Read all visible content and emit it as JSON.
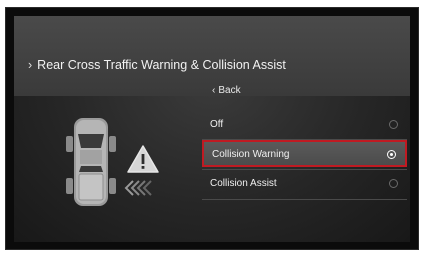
{
  "header": {
    "title": "Rear Cross Traffic Warning & Collision Assist"
  },
  "nav": {
    "back_label": "Back"
  },
  "options": [
    {
      "label": "Off",
      "selected": false
    },
    {
      "label": "Collision Warning",
      "selected": true
    },
    {
      "label": "Collision Assist",
      "selected": false
    }
  ],
  "icons": {
    "title_chevron": "chevron-right-icon",
    "back_chevron": "chevron-left-icon",
    "vehicle": "vehicle-top-view-icon",
    "warning": "warning-triangle-icon",
    "cross_traffic": "cross-traffic-arrows-icon"
  },
  "colors": {
    "highlight_border": "#c01a22",
    "background": "#262626"
  }
}
